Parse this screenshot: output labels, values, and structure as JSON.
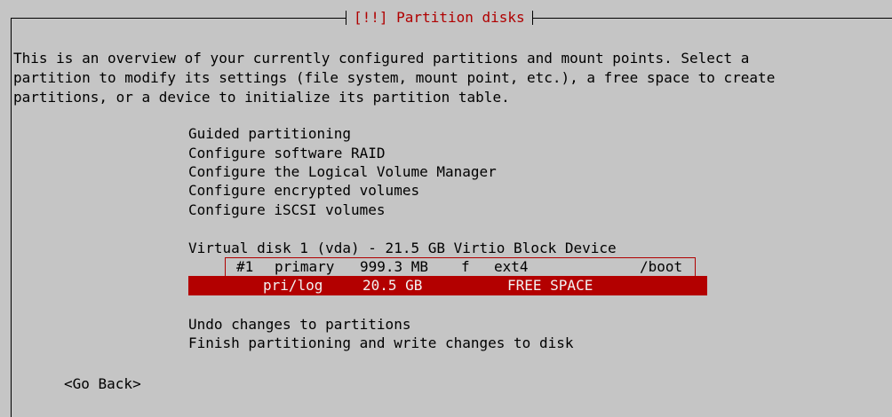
{
  "dialog": {
    "title": "[!!] Partition disks",
    "intro": "This is an overview of your currently configured partitions and mount points. Select a\npartition to modify its settings (file system, mount point, etc.), a free space to create\npartitions, or a device to initialize its partition table."
  },
  "menu": {
    "guided": "Guided partitioning",
    "raid": "Configure software RAID",
    "lvm": "Configure the Logical Volume Manager",
    "encrypted": "Configure encrypted volumes",
    "iscsi": "Configure iSCSI volumes"
  },
  "disk": {
    "label": "Virtual disk 1 (vda) - 21.5 GB Virtio Block Device",
    "partitions": [
      {
        "number": "#1",
        "type": "primary",
        "size": "999.3 MB",
        "flag": "f",
        "fs": "ext4",
        "mount": "/boot"
      },
      {
        "number": "",
        "type": "pri/log",
        "size": "20.5 GB",
        "flag": "",
        "fs": "FREE SPACE",
        "mount": ""
      }
    ]
  },
  "actions": {
    "undo": "Undo changes to partitions",
    "finish": "Finish partitioning and write changes to disk"
  },
  "nav": {
    "back": "<Go Back>"
  },
  "colors": {
    "background": "#c5c5c5",
    "selection": "#b30000",
    "title": "#b00000",
    "text": "#000000"
  }
}
